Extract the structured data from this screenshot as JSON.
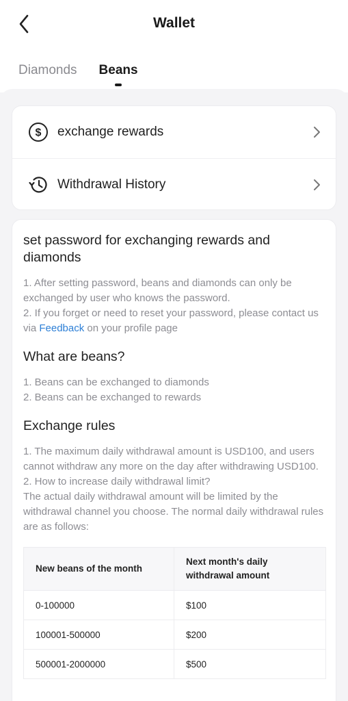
{
  "header": {
    "title": "Wallet",
    "back_icon": "chevron-left-icon"
  },
  "tabs": [
    {
      "label": "Diamonds",
      "active": false
    },
    {
      "label": "Beans",
      "active": true
    }
  ],
  "menu": [
    {
      "label": "exchange rewards",
      "icon": "dollar-circle-icon"
    },
    {
      "label": "Withdrawal History",
      "icon": "history-clock-icon"
    }
  ],
  "info": {
    "password_title": "set password for exchanging rewards and diamonds",
    "password_p1": "1. After setting password, beans and diamonds can only be exchanged by user who knows the password.",
    "password_p2_prefix": "2. If you forget or need to reset your password, please contact us via ",
    "password_p2_link": "Feedback",
    "password_p2_suffix": " on your profile page",
    "beans_title": "What are beans?",
    "beans_p1": "1. Beans can be exchanged to diamonds",
    "beans_p2": "2. Beans can be exchanged to rewards",
    "rules_title": "Exchange rules",
    "rules_p1": "1. The maximum daily withdrawal amount is USD100, and users cannot withdraw any more on the day after withdrawing USD100.",
    "rules_p2": "2. How to increase daily withdrawal limit?",
    "rules_p3": "The actual daily withdrawal amount will be limited by the withdrawal channel you choose. The normal daily withdrawal rules are as follows:"
  },
  "table": {
    "headers": [
      "New beans of the month",
      "Next month's daily withdrawal amount"
    ],
    "rows": [
      [
        "0-100000",
        "$100"
      ],
      [
        "100001-500000",
        "$200"
      ],
      [
        "500001-2000000",
        "$500"
      ]
    ]
  },
  "colors": {
    "link": "#2d7fd6",
    "muted_text": "#8d8d93",
    "background": "#f4f4f6"
  }
}
